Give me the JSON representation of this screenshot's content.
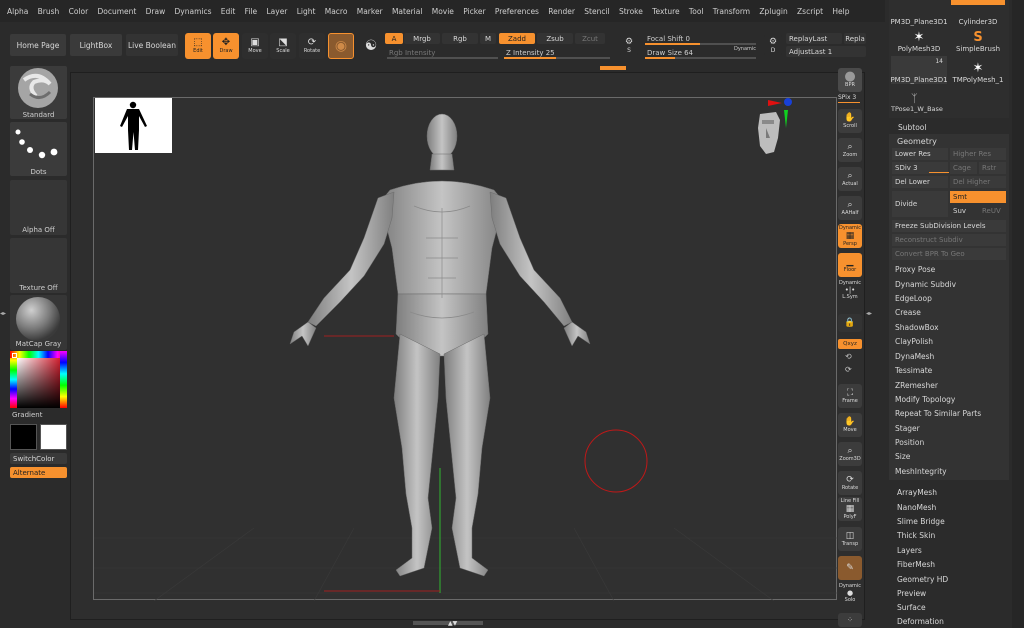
{
  "menu": [
    "Alpha",
    "Brush",
    "Color",
    "Document",
    "Draw",
    "Dynamics",
    "Edit",
    "File",
    "Layer",
    "Light",
    "Macro",
    "Marker",
    "Material",
    "Movie",
    "Picker",
    "Preferences",
    "Render",
    "Stencil",
    "Stroke",
    "Texture",
    "Tool",
    "Transform",
    "Zplugin",
    "Zscript",
    "Help"
  ],
  "top": {
    "home": "Home Page",
    "lightbox": "LightBox",
    "live_boolean": "Live Boolean",
    "edit": "Edit",
    "draw": "Draw",
    "move": "Move",
    "scale": "Scale",
    "rotate": "Rotate",
    "a": "A",
    "mrgb": "Mrgb",
    "rgb": "Rgb",
    "m": "M",
    "zadd": "Zadd",
    "zsub": "Zsub",
    "zcut": "Zcut",
    "rgb_intensity": "Rgb Intensity",
    "z_intensity": "Z Intensity 25",
    "s": "S",
    "focal_shift": "Focal Shift 0",
    "draw_size": "Draw Size 64",
    "dynamic": "Dynamic",
    "d": "D",
    "replay_last": "ReplayLast",
    "repla": "Repla",
    "adjust_last": "AdjustLast 1"
  },
  "left": {
    "standard": "Standard",
    "dots": "Dots",
    "alpha_off": "Alpha Off",
    "texture_off": "Texture Off",
    "matcap": "MatCap Gray",
    "gradient": "Gradient",
    "switch_color": "SwitchColor",
    "alternate": "Alternate"
  },
  "shelf": {
    "bpr": "BPR",
    "spix": "SPix 3",
    "scroll": "Scroll",
    "zoom": "Zoom",
    "actual": "Actual",
    "aahalf": "AAHalf",
    "dynamic_persp": "Dynamic",
    "persp": "Persp",
    "floor": "Floor",
    "dynamic2": "Dynamic",
    "lsym": "L.Sym",
    "xyz": "Qxyz",
    "frame": "Frame",
    "move": "Move",
    "zoom3d": "Zoom3D",
    "rotate": "Rotate",
    "line_fill": "Line Fill",
    "polyf": "PolyF",
    "transp": "Transp",
    "dynamic3": "Dynamic",
    "solo": "Solo"
  },
  "tools": {
    "pm3d1": "PM3D_Plane3D1",
    "cyl": "Cylinder3D",
    "polymesh": "PolyMesh3D",
    "simplebrush": "SimpleBrush",
    "count": "14",
    "pm3d2": "PM3D_Plane3D1",
    "tmpoly": "TMPolyMesh_1",
    "tpose": "TPose1_W_Base"
  },
  "subtool": "Subtool",
  "geometry": {
    "title": "Geometry",
    "lower_res": "Lower Res",
    "higher_res": "Higher Res",
    "sdiv": "SDiv 3",
    "cage": "Cage",
    "rstr": "Rstr",
    "del_lower": "Del Lower",
    "del_higher": "Del Higher",
    "divide": "Divide",
    "smt": "Smt",
    "suv": "Suv",
    "reuv": "ReUV",
    "freeze": "Freeze SubDivision Levels",
    "reconstruct": "Reconstruct Subdiv",
    "convert": "Convert BPR To Geo",
    "items": [
      "Proxy Pose",
      "Dynamic Subdiv",
      "EdgeLoop",
      "Crease",
      "ShadowBox",
      "ClayPolish",
      "DynaMesh",
      "Tessimate",
      "ZRemesher",
      "Modify Topology",
      "Repeat To Similar Parts",
      "Stager",
      "Position",
      "Size",
      "MeshIntegrity"
    ]
  },
  "sub_items": [
    "ArrayMesh",
    "NanoMesh",
    "Slime Bridge",
    "Thick Skin",
    "Layers",
    "FiberMesh",
    "Geometry HD",
    "Preview",
    "Surface",
    "Deformation"
  ]
}
